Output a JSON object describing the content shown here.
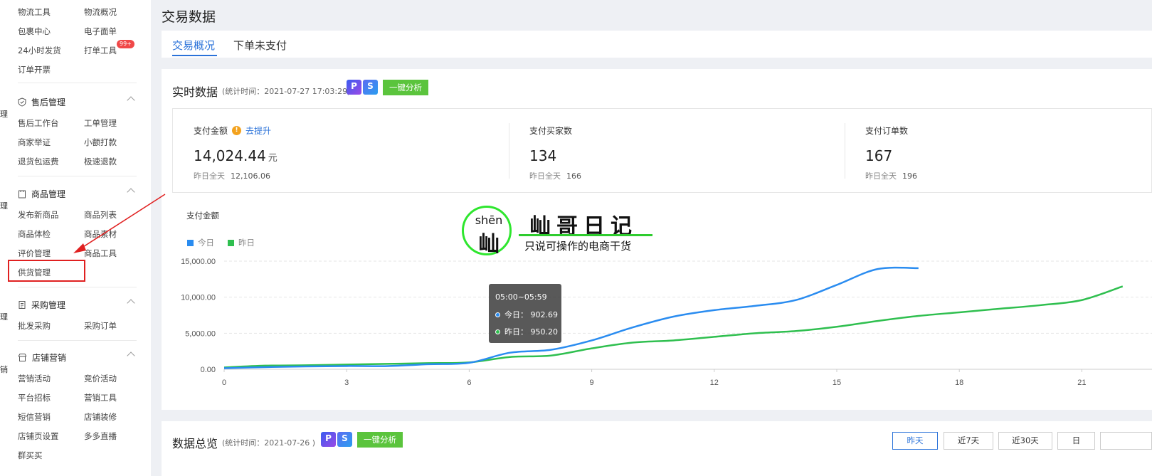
{
  "page": {
    "title": "交易数据"
  },
  "tabs": [
    {
      "label": "交易概况",
      "active": true
    },
    {
      "label": "下单未支付",
      "active": false
    }
  ],
  "sidebar": {
    "edge_glyphs": [
      "理",
      "理",
      "理",
      "销"
    ],
    "top_items": [
      [
        "物流工具",
        "物流概况"
      ],
      [
        "包裹中心",
        "电子面单"
      ],
      [
        "24小时发货",
        "打单工具"
      ],
      [
        "订单开票",
        ""
      ]
    ],
    "badge": "99+",
    "groups": [
      {
        "title": "售后管理",
        "icon": "shield-icon",
        "items": [
          [
            "售后工作台",
            "工单管理"
          ],
          [
            "商家举证",
            "小额打款"
          ],
          [
            "退货包运费",
            "极速退款"
          ]
        ]
      },
      {
        "title": "商品管理",
        "icon": "bag-icon",
        "items": [
          [
            "发布新商品",
            "商品列表"
          ],
          [
            "商品体检",
            "商品素材"
          ],
          [
            "评价管理",
            "商品工具"
          ],
          [
            "供货管理",
            ""
          ]
        ]
      },
      {
        "title": "采购管理",
        "icon": "clipboard-icon",
        "items": [
          [
            "批发采购",
            "采购订单"
          ]
        ]
      },
      {
        "title": "店铺营销",
        "icon": "store-icon",
        "items": [
          [
            "营销活动",
            "竞价活动"
          ],
          [
            "平台招标",
            "营销工具"
          ],
          [
            "短信营销",
            "店铺装修"
          ],
          [
            "店铺页设置",
            "多多直播"
          ],
          [
            "群买买",
            ""
          ]
        ]
      }
    ]
  },
  "realtime": {
    "title": "实时数据",
    "subtitle": "(统计时间：2021-07-27 17:03:29)",
    "badge_p": "P",
    "badge_s": "S",
    "analyze": "一键分析",
    "stats": [
      {
        "label": "支付金额",
        "warn": "!",
        "link": "去提升",
        "value": "14,024.44",
        "unit": "元",
        "yest_label": "昨日全天",
        "yest_value": "12,106.06"
      },
      {
        "label": "支付买家数",
        "warn": "",
        "link": "",
        "value": "134",
        "unit": "",
        "yest_label": "昨日全天",
        "yest_value": "166"
      },
      {
        "label": "支付订单数",
        "warn": "",
        "link": "",
        "value": "167",
        "unit": "",
        "yest_label": "昨日全天",
        "yest_value": "196"
      }
    ]
  },
  "chart_data": {
    "type": "line",
    "title": "支付金额",
    "x_ticks": [
      0,
      3,
      6,
      9,
      12,
      15,
      18,
      21
    ],
    "y_ticks": [
      "0.00",
      "5,000.00",
      "10,000.00",
      "15,000.00"
    ],
    "ylim": [
      0,
      15000
    ],
    "xlim": [
      0,
      24
    ],
    "colors": {
      "today": "#2a8cf0",
      "yesterday": "#2fbf4f"
    },
    "series": [
      {
        "name": "今日",
        "x": [
          0,
          1,
          2,
          3,
          4,
          5,
          6,
          7,
          8,
          9,
          10,
          11,
          12,
          13,
          14,
          15,
          16,
          17
        ],
        "values": [
          150,
          300,
          400,
          450,
          450,
          700,
          902.69,
          2300,
          2700,
          4000,
          5800,
          7300,
          8200,
          8800,
          9600,
          11700,
          13900,
          14024.44
        ]
      },
      {
        "name": "昨日",
        "x": [
          0,
          1,
          2,
          3,
          4,
          5,
          6,
          7,
          8,
          9,
          10,
          11,
          12,
          13,
          14,
          15,
          16,
          17,
          18,
          19,
          20,
          21,
          22
        ],
        "values": [
          250,
          500,
          550,
          650,
          750,
          850,
          950.2,
          1700,
          1900,
          2900,
          3700,
          4000,
          4500,
          5000,
          5300,
          5900,
          6700,
          7400,
          7900,
          8400,
          8900,
          9600,
          11500
        ]
      }
    ],
    "tooltip": {
      "title": "05:00~05:59",
      "today": "今日： 902.69",
      "yesterday": "昨日： 950.20"
    }
  },
  "watermark": {
    "pinyin": "shēn",
    "char": "屾",
    "title": "屾哥日记",
    "slogan": "只说可操作的电商干货"
  },
  "overview": {
    "title": "数据总览",
    "subtitle": "(统计时间：2021-07-26 )",
    "analyze": "一键分析",
    "ranges": [
      {
        "label": "昨天",
        "active": true
      },
      {
        "label": "近7天",
        "active": false
      },
      {
        "label": "近30天",
        "active": false
      },
      {
        "label": "日",
        "active": false
      },
      {
        "label": "",
        "active": false
      }
    ]
  }
}
